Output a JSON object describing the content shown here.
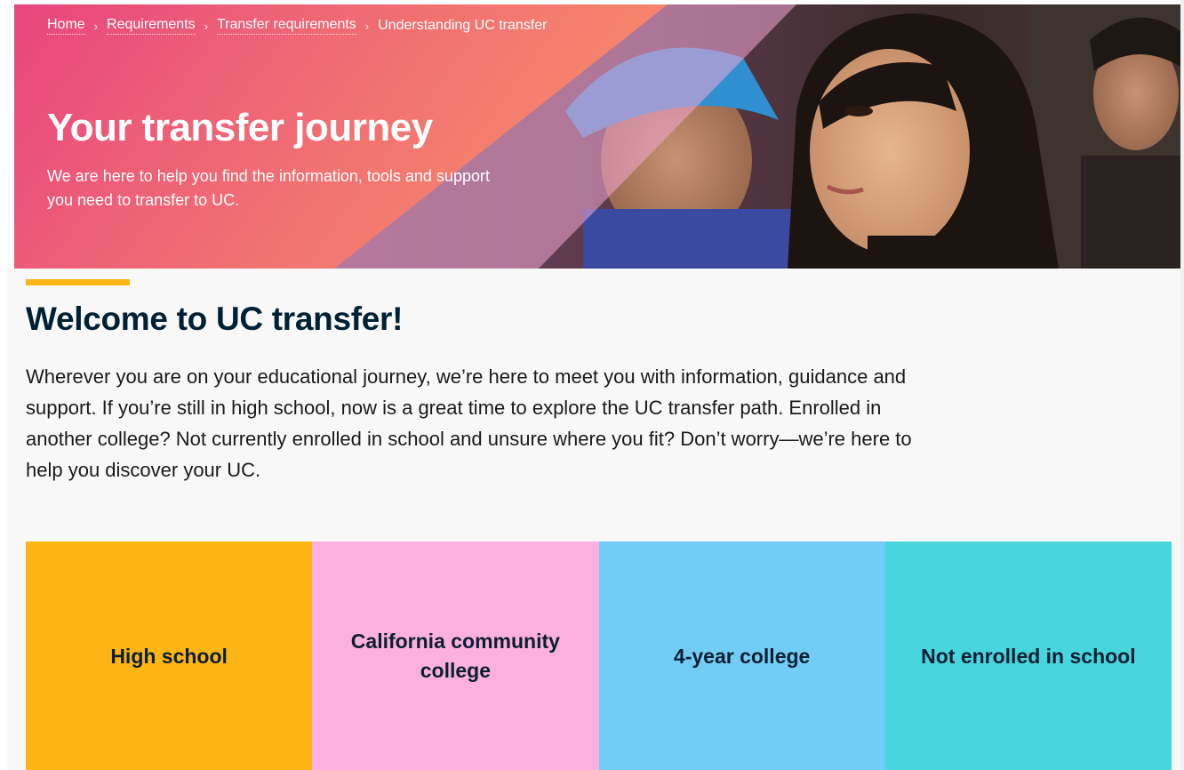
{
  "breadcrumb": {
    "items": [
      {
        "label": "Home"
      },
      {
        "label": "Requirements"
      },
      {
        "label": "Transfer requirements"
      }
    ],
    "separator": "›",
    "current": "Understanding UC transfer"
  },
  "hero": {
    "title": "Your transfer journey",
    "subtitle": "We are here to help you find the information, tools and support you need to transfer to UC."
  },
  "welcome": {
    "title": "Welcome to UC transfer!",
    "body": "Wherever you are on your educational journey, we’re here to meet you with information, guidance and support. If you’re still in high school, now is a great time to explore the UC transfer path. Enrolled in another college? Not currently enrolled in school and unsure where you fit? Don’t worry—we’re here to help you discover your UC."
  },
  "cards": [
    {
      "label": "High school",
      "color": "#fdb515"
    },
    {
      "label": "California community college",
      "color": "#fcb0e0"
    },
    {
      "label": "4-year college",
      "color": "#72cdf4"
    },
    {
      "label": "Not enrolled in school",
      "color": "#48d6de"
    }
  ],
  "colors": {
    "accent": "#fdb515",
    "hero_gradient_start": "#e8457e",
    "hero_gradient_end": "#f78a6a",
    "heading": "#002033"
  }
}
